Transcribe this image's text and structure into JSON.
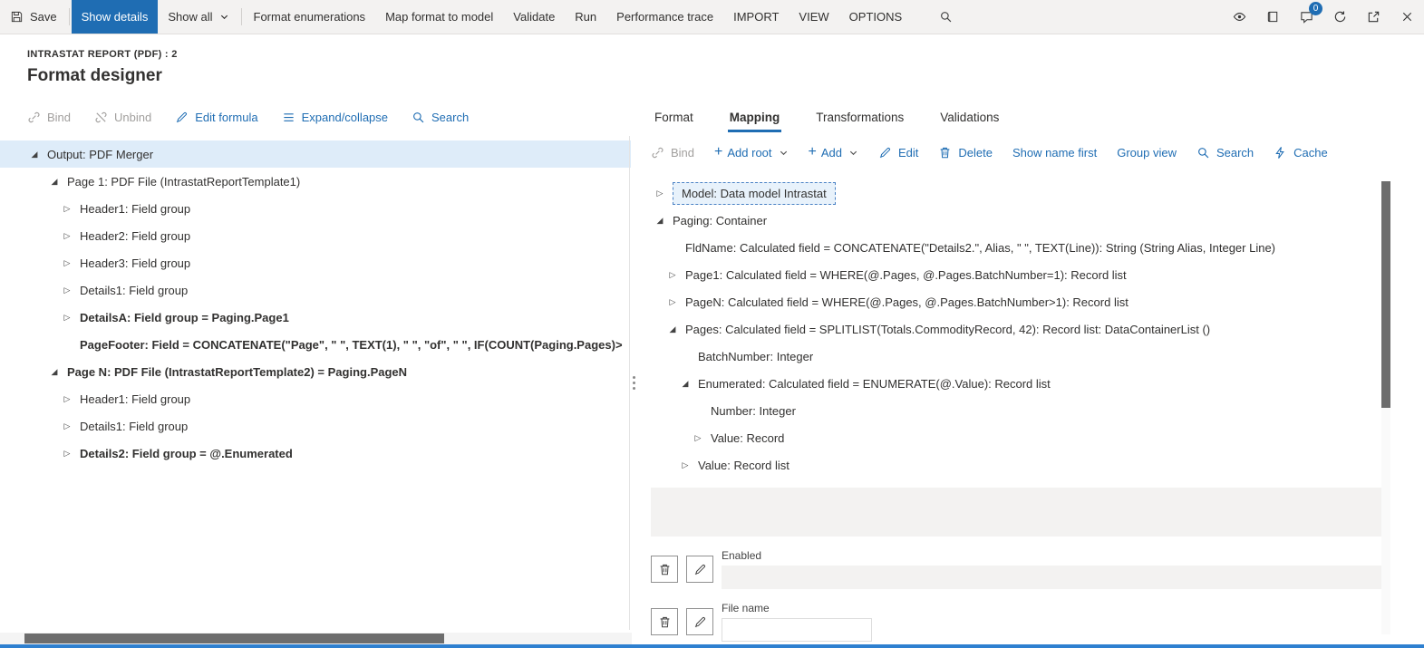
{
  "colors": {
    "accent": "#1f6db3",
    "link": "#1f6db3",
    "selection": "#deecf9",
    "topbar-bg": "#f3f2f1",
    "disabled": "#a19f9d",
    "scroll-thumb": "#6d6d6d",
    "bottom-bar": "#2e80d0",
    "badge": "#1f6db3"
  },
  "icons": {
    "expanded": "◢",
    "collapsed": "▷",
    "plus": "+"
  },
  "topbar": {
    "save": "Save",
    "show_details": "Show details",
    "show_all": "Show all",
    "format_enumerations": "Format enumerations",
    "map_format_to_model": "Map format to model",
    "validate": "Validate",
    "run": "Run",
    "performance_trace": "Performance trace",
    "import": "IMPORT",
    "view": "VIEW",
    "options": "OPTIONS",
    "message_badge": "0"
  },
  "header": {
    "record_caption": "INTRASTAT REPORT (PDF) : 2",
    "page_title": "Format designer"
  },
  "left_pane": {
    "toolbar": {
      "bind": "Bind",
      "unbind": "Unbind",
      "edit_formula": "Edit formula",
      "expand_collapse": "Expand/collapse",
      "search": "Search"
    },
    "tree": [
      {
        "label": "Output: PDF Merger",
        "level": 0,
        "state": "expanded",
        "selected": true
      },
      {
        "label": "Page 1: PDF File (IntrastatReportTemplate1)",
        "level": 1,
        "state": "expanded"
      },
      {
        "label": "Header1: Field group",
        "level": 2,
        "state": "collapsed"
      },
      {
        "label": "Header2: Field group",
        "level": 2,
        "state": "collapsed"
      },
      {
        "label": "Header3: Field group",
        "level": 2,
        "state": "collapsed"
      },
      {
        "label": "Details1: Field group",
        "level": 2,
        "state": "collapsed"
      },
      {
        "label": "DetailsA: Field group = Paging.Page1",
        "level": 2,
        "state": "collapsed",
        "bold": true
      },
      {
        "label": "PageFooter: Field = CONCATENATE(\"Page\", \" \", TEXT(1), \" \", \"of\", \" \", IF(COUNT(Paging.Pages)>",
        "level": 2,
        "state": "leaf",
        "bold": true
      },
      {
        "label": "Page N: PDF File (IntrastatReportTemplate2) = Paging.PageN",
        "level": 1,
        "state": "expanded",
        "bold": true
      },
      {
        "label": "Header1: Field group",
        "level": 2,
        "state": "collapsed"
      },
      {
        "label": "Details1: Field group",
        "level": 2,
        "state": "collapsed"
      },
      {
        "label": "Details2: Field group = @.Enumerated",
        "level": 2,
        "state": "collapsed",
        "bold": true
      }
    ]
  },
  "right_pane": {
    "tabs": [
      "Format",
      "Mapping",
      "Transformations",
      "Validations"
    ],
    "active_tab": "Mapping",
    "toolbar": {
      "bind": "Bind",
      "add_root": "Add root",
      "add": "Add",
      "edit": "Edit",
      "delete": "Delete",
      "show_name_first": "Show name first",
      "group_view": "Group view",
      "search": "Search",
      "cache": "Cache"
    },
    "tree": [
      {
        "label": "Model: Data model Intrastat",
        "level": 0,
        "state": "collapsed",
        "selected": true
      },
      {
        "label": "Paging: Container",
        "level": 0,
        "state": "expanded"
      },
      {
        "label": "FldName: Calculated field = CONCATENATE(\"Details2.\", Alias, \" \", TEXT(Line)): String (String Alias, Integer Line)",
        "level": 1,
        "state": "leaf"
      },
      {
        "label": "Page1: Calculated field = WHERE(@.Pages, @.Pages.BatchNumber=1): Record list",
        "level": 1,
        "state": "collapsed"
      },
      {
        "label": "PageN: Calculated field = WHERE(@.Pages, @.Pages.BatchNumber>1): Record list",
        "level": 1,
        "state": "collapsed"
      },
      {
        "label": "Pages: Calculated field = SPLITLIST(Totals.CommodityRecord, 42): Record list: DataContainerList ()",
        "level": 1,
        "state": "expanded"
      },
      {
        "label": "BatchNumber: Integer",
        "level": 2,
        "state": "leaf"
      },
      {
        "label": "Enumerated: Calculated field = ENUMERATE(@.Value): Record list",
        "level": 2,
        "state": "expanded"
      },
      {
        "label": "Number: Integer",
        "level": 3,
        "state": "leaf"
      },
      {
        "label": "Value: Record",
        "level": 3,
        "state": "collapsed"
      },
      {
        "label": "Value: Record list",
        "level": 2,
        "state": "collapsed"
      }
    ],
    "details": {
      "enabled_label": "Enabled",
      "enabled_value": "",
      "file_name_label": "File name",
      "file_name_value": ""
    }
  }
}
